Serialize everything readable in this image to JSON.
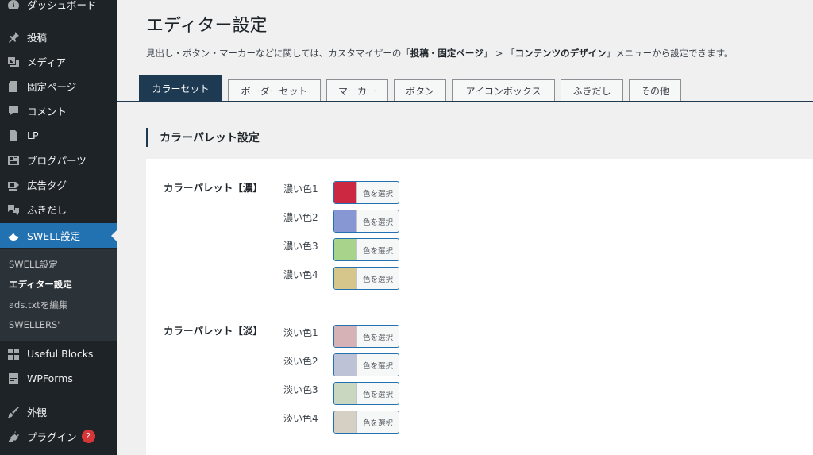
{
  "sidebar": {
    "items": [
      {
        "label": "ダッシュボード",
        "icon": "dashboard-icon"
      },
      {
        "label": "投稿",
        "icon": "pin-icon"
      },
      {
        "label": "メディア",
        "icon": "media-icon"
      },
      {
        "label": "固定ページ",
        "icon": "page-icon"
      },
      {
        "label": "コメント",
        "icon": "comment-icon"
      },
      {
        "label": "LP",
        "icon": "document-icon"
      },
      {
        "label": "ブログパーツ",
        "icon": "layout-icon"
      },
      {
        "label": "広告タグ",
        "icon": "tag-icon"
      },
      {
        "label": "ふきだし",
        "icon": "speech-bubble-icon"
      },
      {
        "label": "SWELL設定",
        "icon": "swell-icon"
      },
      {
        "label": "Useful Blocks",
        "icon": "blocks-icon"
      },
      {
        "label": "WPForms",
        "icon": "forms-icon"
      },
      {
        "label": "外観",
        "icon": "brush-icon"
      },
      {
        "label": "プラグイン",
        "icon": "plugin-icon",
        "badge": "2"
      }
    ],
    "submenu": [
      {
        "label": "SWELL設定"
      },
      {
        "label": "エディター設定"
      },
      {
        "label": "ads.txtを編集"
      },
      {
        "label": "SWELLERS'"
      }
    ]
  },
  "page": {
    "title": "エディター設定",
    "description_prefix": "見出し・ボタン・マーカーなどに関しては、カスタマイザーの「",
    "description_bold1": "投稿・固定ページ",
    "description_mid": "」 > 「",
    "description_bold2": "コンテンツのデザイン",
    "description_suffix": "」メニューから設定できます。"
  },
  "tabs": [
    "カラーセット",
    "ボーダーセット",
    "マーカー",
    "ボタン",
    "アイコンボックス",
    "ふきだし",
    "その他"
  ],
  "section": {
    "title": "カラーパレット設定"
  },
  "palettes": {
    "dark": {
      "label": "カラーパレット【濃】",
      "rows": [
        {
          "label": "濃い色1",
          "color": "#cc2841"
        },
        {
          "label": "濃い色2",
          "color": "#8797d4"
        },
        {
          "label": "濃い色3",
          "color": "#a8d38a"
        },
        {
          "label": "濃い色4",
          "color": "#d6c68c"
        }
      ]
    },
    "light": {
      "label": "カラーパレット【淡】",
      "rows": [
        {
          "label": "淡い色1",
          "color": "#d6b1b5"
        },
        {
          "label": "淡い色2",
          "color": "#bdc2d6"
        },
        {
          "label": "淡い色3",
          "color": "#c9d6c0"
        },
        {
          "label": "淡い色4",
          "color": "#d6cfc3"
        }
      ]
    },
    "button_label": "色を選択"
  }
}
